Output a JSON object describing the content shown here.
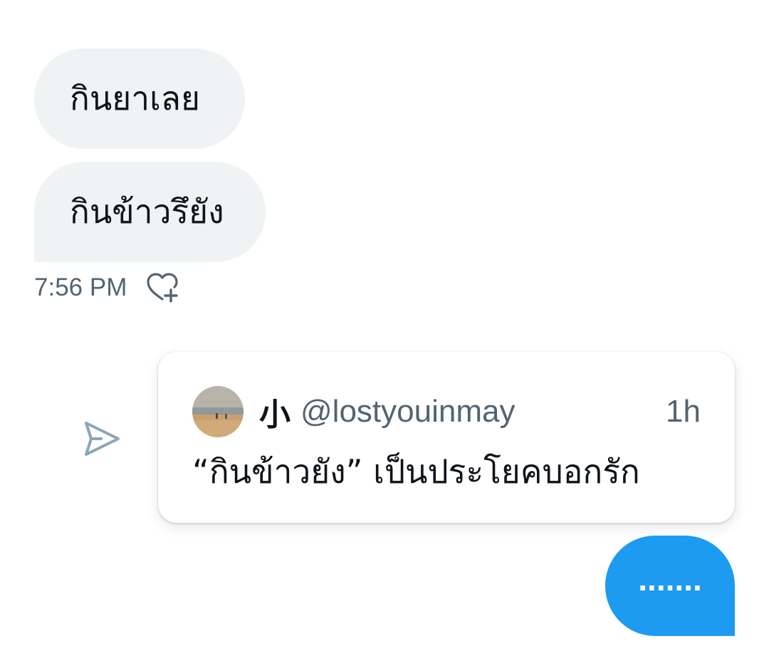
{
  "conversation": {
    "received": [
      {
        "text": "กินยาเลย"
      },
      {
        "text": "กินข้าวรึยัง"
      }
    ],
    "received_time": "7:56 PM",
    "shared_post": {
      "display_name": "小",
      "handle": "@lostyouinmay",
      "time_ago": "1h",
      "text": "“กินข้าวยัง” เป็นประโยคบอกรัก",
      "avatar_icon": "beach-photo-avatar"
    },
    "sent": [
      {
        "text": "......."
      }
    ]
  },
  "icons": {
    "like": "heart-plus-icon",
    "share": "send-arrow-icon"
  },
  "colors": {
    "received_bubble": "#eff3f4",
    "sent_bubble": "#1d9bf0",
    "secondary_text": "#536471",
    "primary_text": "#0f1419",
    "share_icon": "#8ba6b8"
  }
}
